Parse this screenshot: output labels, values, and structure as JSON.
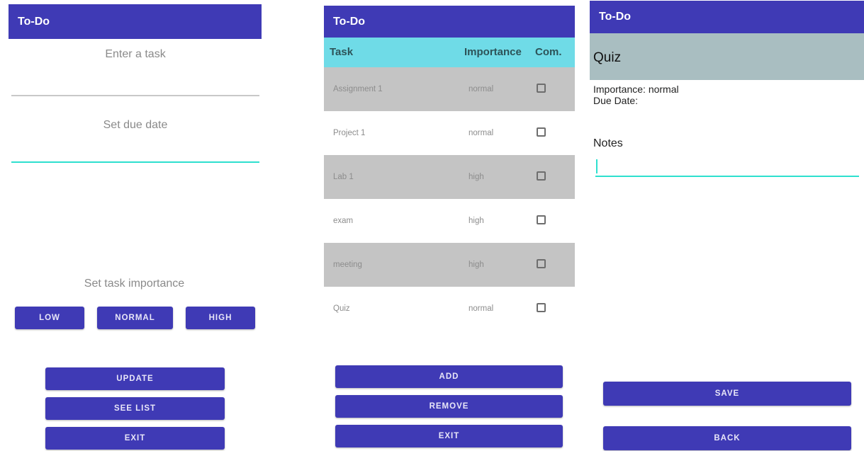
{
  "colors": {
    "primary": "#3f3ab5",
    "accent": "#2ee0cf",
    "table_header": "#6fdbe7",
    "row_alt": "#c4c4c4",
    "detail_band": "#a9bec1"
  },
  "screen1": {
    "app_title": "To-Do",
    "task_input_placeholder": "Enter a task",
    "due_date_placeholder": "Set due date",
    "importance_label": "Set task importance",
    "importance_buttons": [
      "LOW",
      "NORMAL",
      "HIGH"
    ],
    "actions": [
      "UPDATE",
      "SEE LIST",
      "EXIT"
    ]
  },
  "screen2": {
    "app_title": "To-Do",
    "columns": [
      "Task",
      "Importance",
      "Com."
    ],
    "rows": [
      {
        "task": "Assignment 1",
        "importance": "normal",
        "completed": false
      },
      {
        "task": "Project 1",
        "importance": "normal",
        "completed": false
      },
      {
        "task": "Lab 1",
        "importance": "high",
        "completed": false
      },
      {
        "task": "exam",
        "importance": "high",
        "completed": false
      },
      {
        "task": "meeting",
        "importance": "high",
        "completed": false
      },
      {
        "task": "Quiz",
        "importance": "normal",
        "completed": false
      }
    ],
    "actions": [
      "ADD",
      "REMOVE",
      "EXIT"
    ]
  },
  "screen3": {
    "app_title": "To-Do",
    "task_name": "Quiz",
    "importance_line": "Importance: normal",
    "due_date_line": "Due Date:",
    "notes_label": "Notes",
    "notes_value": "",
    "actions": [
      "SAVE",
      "BACK"
    ]
  }
}
